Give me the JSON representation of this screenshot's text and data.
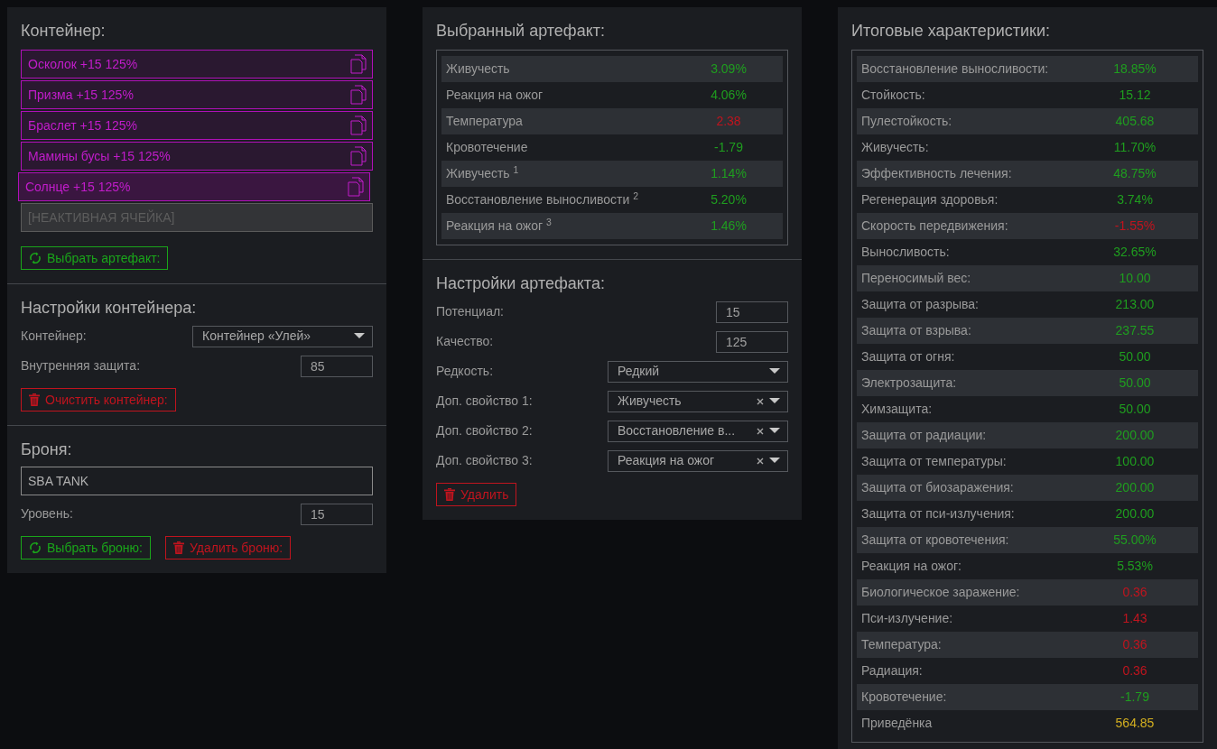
{
  "container_panel": {
    "title": "Контейнер:",
    "slots": [
      {
        "kind": "artifact",
        "label": "Осколок +15 125%",
        "selected": false
      },
      {
        "kind": "artifact",
        "label": "Призма +15 125%",
        "selected": false
      },
      {
        "kind": "artifact",
        "label": "Браслет +15 125%",
        "selected": false
      },
      {
        "kind": "artifact",
        "label": "Мамины бусы +15 125%",
        "selected": false
      },
      {
        "kind": "artifact",
        "label": "Солнце +15 125%",
        "selected": true
      },
      {
        "kind": "inactive",
        "label": "[НЕАКТИВНАЯ ЯЧЕЙКА]"
      }
    ],
    "select_button": "Выбрать артефакт:"
  },
  "container_settings": {
    "title": "Настройки контейнера:",
    "fields": [
      {
        "kind": "select",
        "label": "Контейнер:",
        "value": "Контейнер «Улей»",
        "clearable": false
      },
      {
        "kind": "number",
        "label": "Внутренняя защита:",
        "value": "85"
      }
    ],
    "clear_button": "Очистить контейнер:"
  },
  "armor": {
    "title": "Броня:",
    "name_value": "SBA TANK",
    "fields": [
      {
        "kind": "number",
        "label": "Уровень:",
        "value": "15"
      }
    ],
    "select_button": "Выбрать броню:",
    "delete_button": "Удалить броню:"
  },
  "selected_artifact": {
    "title": "Выбранный артефакт:",
    "stats": [
      {
        "label": "Живучесть",
        "value": "3.09%",
        "color": "#1f9e1f"
      },
      {
        "label": "Реакция на ожог",
        "value": "4.06%",
        "color": "#1f9e1f"
      },
      {
        "label": "Температура",
        "value": "2.38",
        "color": "#c0141e"
      },
      {
        "label": "Кровотечение",
        "value": "-1.79",
        "color": "#1f9e1f"
      },
      {
        "label": "Живучесть $^{1}$",
        "value": "1.14%",
        "color": "#1f9e1f"
      },
      {
        "label": "Восстановление выносливости $^{2}$",
        "value": "5.20%",
        "color": "#1f9e1f"
      },
      {
        "label": "Реакция на ожог $^{3}$",
        "value": "1.46%",
        "color": "#1f9e1f"
      }
    ]
  },
  "artifact_settings": {
    "title": "Настройки артефакта:",
    "fields": [
      {
        "kind": "number",
        "label": "Потенциал:",
        "value": "15"
      },
      {
        "kind": "number",
        "label": "Качество:",
        "value": "125"
      },
      {
        "kind": "select",
        "label": "Редкость:",
        "value": "Редкий",
        "clearable": false
      },
      {
        "kind": "select",
        "label": "Доп. свойство 1:",
        "value": "Живучесть",
        "clearable": true
      },
      {
        "kind": "select",
        "label": "Доп. свойство 2:",
        "value": "Восстановление в...",
        "clearable": true
      },
      {
        "kind": "select",
        "label": "Доп. свойство 3:",
        "value": "Реакция на ожог",
        "clearable": true
      }
    ],
    "delete_button": "Удалить"
  },
  "totals": {
    "title": "Итоговые характеристики:",
    "stats": [
      {
        "label": "Восстановление выносливости:",
        "value": "18.85%",
        "color": "#1f9e1f"
      },
      {
        "label": "Стойкость:",
        "value": "15.12",
        "color": "#1f9e1f"
      },
      {
        "label": "Пулестойкость:",
        "value": "405.68",
        "color": "#1f9e1f"
      },
      {
        "label": "Живучесть:",
        "value": "11.70%",
        "color": "#1f9e1f"
      },
      {
        "label": "Эффективность лечения:",
        "value": "48.75%",
        "color": "#1f9e1f"
      },
      {
        "label": "Регенерация здоровья:",
        "value": "3.74%",
        "color": "#1f9e1f"
      },
      {
        "label": "Скорость передвижения:",
        "value": "-1.55%",
        "color": "#c0141e"
      },
      {
        "label": "Выносливость:",
        "value": "32.65%",
        "color": "#1f9e1f"
      },
      {
        "label": "Переносимый вес:",
        "value": "10.00",
        "color": "#1f9e1f"
      },
      {
        "label": "Защита от разрыва:",
        "value": "213.00",
        "color": "#1f9e1f"
      },
      {
        "label": "Защита от взрыва:",
        "value": "237.55",
        "color": "#1f9e1f"
      },
      {
        "label": "Защита от огня:",
        "value": "50.00",
        "color": "#1f9e1f"
      },
      {
        "label": "Электрозащита:",
        "value": "50.00",
        "color": "#1f9e1f"
      },
      {
        "label": "Химзащита:",
        "value": "50.00",
        "color": "#1f9e1f"
      },
      {
        "label": "Защита от радиации:",
        "value": "200.00",
        "color": "#1f9e1f"
      },
      {
        "label": "Защита от температуры:",
        "value": "100.00",
        "color": "#1f9e1f"
      },
      {
        "label": "Защита от биозаражения:",
        "value": "200.00",
        "color": "#1f9e1f"
      },
      {
        "label": "Защита от пси-излучения:",
        "value": "200.00",
        "color": "#1f9e1f"
      },
      {
        "label": "Защита от кровотечения:",
        "value": "55.00%",
        "color": "#1f9e1f"
      },
      {
        "label": "Реакция на ожог:",
        "value": "5.53%",
        "color": "#1f9e1f"
      },
      {
        "label": "Биологическое заражение:",
        "value": "0.36",
        "color": "#c0141e"
      },
      {
        "label": "Пси-излучение:",
        "value": "1.43",
        "color": "#c0141e"
      },
      {
        "label": "Температура:",
        "value": "0.36",
        "color": "#c0141e"
      },
      {
        "label": "Радиация:",
        "value": "0.36",
        "color": "#c0141e"
      },
      {
        "label": "Кровотечение:",
        "value": "-1.79",
        "color": "#1f9e1f"
      },
      {
        "label": "Приведёнка",
        "value": "564.85",
        "color": "#d4b020"
      }
    ]
  }
}
